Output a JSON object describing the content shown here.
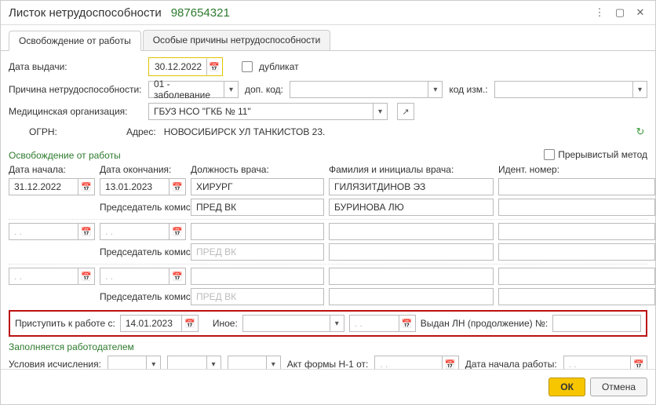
{
  "title": {
    "main": "Листок нетрудоспособности",
    "number": "987654321"
  },
  "tabs": {
    "t0": "Освобождение от работы",
    "t1": "Особые причины нетрудоспособности"
  },
  "labels": {
    "issue_date": "Дата выдачи:",
    "duplicate": "дубликат",
    "reason": "Причина нетрудоспособности:",
    "add_code": "доп. код:",
    "code_change": "код изм.:",
    "med_org": "Медицинская организация:",
    "ogrn": "ОГРН:",
    "address_prefix": "Адрес:",
    "section_release": "Освобождение от работы",
    "intermittent": "Прерывистый метод",
    "col_start": "Дата начала:",
    "col_end": "Дата окончания:",
    "col_position": "Должность врача:",
    "col_fio": "Фамилия и инициалы врача:",
    "col_ident": "Идент. номер:",
    "chairman": "Председатель комиссии:",
    "chair_ph": "ПРЕД ВК",
    "return_label": "Приступить к работе с:",
    "other": "Иное:",
    "ln_cont": "Выдан ЛН (продолжение) №:",
    "employer_section": "Заполняется работодателем",
    "calc_cond": "Условия исчисления:",
    "act_h1": "Акт формы Н-1 от:",
    "work_start": "Дата начала работы:",
    "empty_date": ". .",
    "longer_empty_date": ".  .    "
  },
  "values": {
    "issue_date": "30.12.2022",
    "reason": "01 - заболевание",
    "med_org": "ГБУЗ НСО \"ГКБ № 11\"",
    "address": "НОВОСИБИРСК УЛ ТАНКИСТОВ 23.",
    "return_date": "14.01.2023"
  },
  "work_release": {
    "rows": [
      {
        "start": "31.12.2022",
        "end": "13.01.2023",
        "position": "ХИРУРГ",
        "fio": "ГИЛЯЗИТДИНОВ ЭЗ",
        "ident": "",
        "chair_fio": "БУРИНОВА ЛЮ"
      }
    ]
  },
  "buttons": {
    "ok": "ОК",
    "cancel": "Отмена"
  }
}
